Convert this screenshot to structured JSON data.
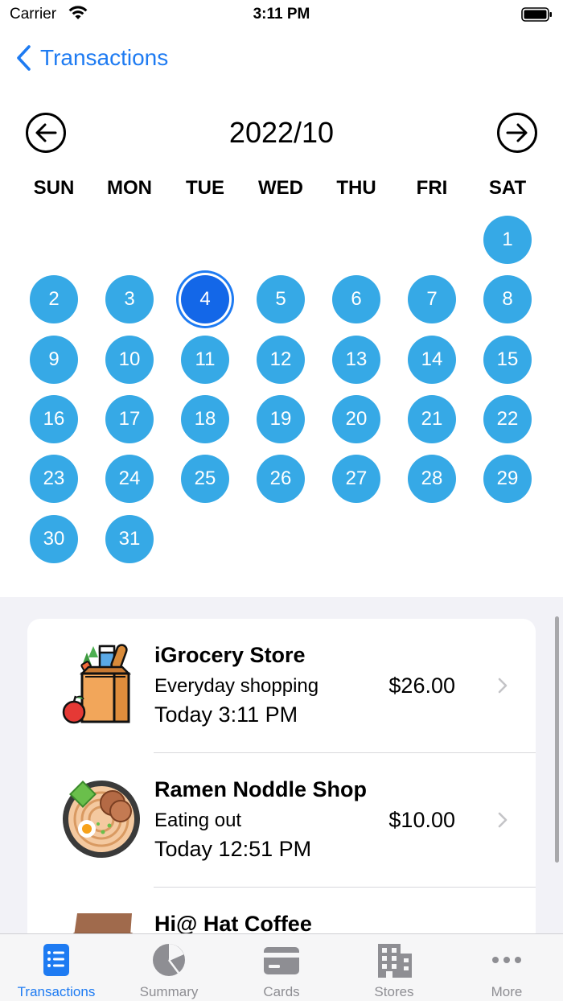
{
  "status_bar": {
    "carrier": "Carrier",
    "time": "3:11 PM"
  },
  "nav": {
    "back_label": "Transactions"
  },
  "calendar": {
    "month_label": "2022/10",
    "weekdays": [
      "SUN",
      "MON",
      "TUE",
      "WED",
      "THU",
      "FRI",
      "SAT"
    ],
    "first_weekday_index": 6,
    "days": [
      "1",
      "2",
      "3",
      "4",
      "5",
      "6",
      "7",
      "8",
      "9",
      "10",
      "11",
      "12",
      "13",
      "14",
      "15",
      "16",
      "17",
      "18",
      "19",
      "20",
      "21",
      "22",
      "23",
      "24",
      "25",
      "26",
      "27",
      "28",
      "29",
      "30",
      "31"
    ],
    "selected_day": "4",
    "colors": {
      "day": "#36a9e6",
      "selected": "#1367e8",
      "accent": "#1e7bf2"
    }
  },
  "transactions": [
    {
      "name": "iGrocery Store",
      "category": "Everyday shopping",
      "time": "Today 3:11 PM",
      "amount": "$26.00",
      "icon": "grocery-bag-icon"
    },
    {
      "name": "Ramen Noddle Shop",
      "category": "Eating out",
      "time": "Today 12:51 PM",
      "amount": "$10.00",
      "icon": "ramen-bowl-icon"
    },
    {
      "name": "Hi@ Hat Coffee",
      "category": "",
      "time": "",
      "amount": "",
      "icon": "coffee-icon"
    }
  ],
  "tabbar": {
    "active_index": 0,
    "tabs": [
      {
        "label": "Transactions",
        "icon": "list-icon"
      },
      {
        "label": "Summary",
        "icon": "pie-chart-icon"
      },
      {
        "label": "Cards",
        "icon": "credit-card-icon"
      },
      {
        "label": "Stores",
        "icon": "building-icon"
      },
      {
        "label": "More",
        "icon": "more-icon"
      }
    ]
  }
}
